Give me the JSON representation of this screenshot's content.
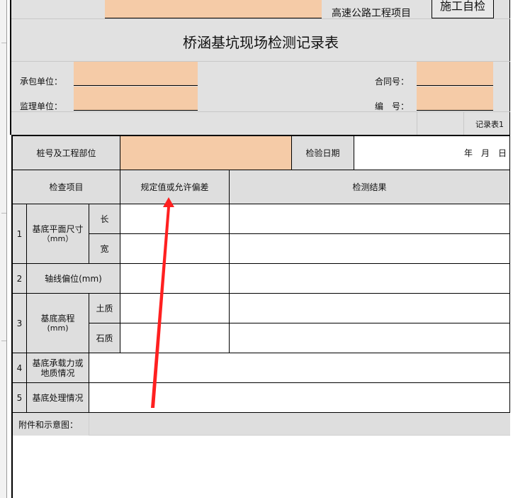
{
  "header": {
    "project_type": "高速公路工程项目",
    "inspection_button": "施工自检",
    "form_title": "桥涵基坑现场检测记录表",
    "contractor_label": "承包单位：",
    "supervisor_label": "监理单位：",
    "contract_no_label": "合同号：",
    "serial_no_label": "编　号：",
    "record_table_no": "记录表1"
  },
  "form": {
    "station_label": "桩号及工程部位",
    "inspection_date_label": "检验日期",
    "date_units": "年　月　日",
    "col_item": "检查项目",
    "col_spec": "规定值或允许偏差",
    "col_result": "检测结果",
    "rows": {
      "r1_no": "1",
      "r1_name": "基底平面尺寸",
      "r1_unit": "（mm）",
      "r1_sub_a": "长",
      "r1_sub_b": "宽",
      "r2_no": "2",
      "r2_name": "轴线偏位(mm)",
      "r3_no": "3",
      "r3_name": "基底高程",
      "r3_unit": "(mm)",
      "r3_sub_a": "土质",
      "r3_sub_b": "石质",
      "r4_no": "4",
      "r4_name_1": "基底承载力或",
      "r4_name_2": "地质情况",
      "r5_no": "5",
      "r5_name": "基底处理情况"
    },
    "attachment_label": "附件和示意图："
  },
  "annotation": {
    "arrow_color": "#ff2020"
  },
  "colors": {
    "header_bg": "#e1e1e1",
    "input_fill": "#f5cba7",
    "cell_gray": "#dedede"
  }
}
